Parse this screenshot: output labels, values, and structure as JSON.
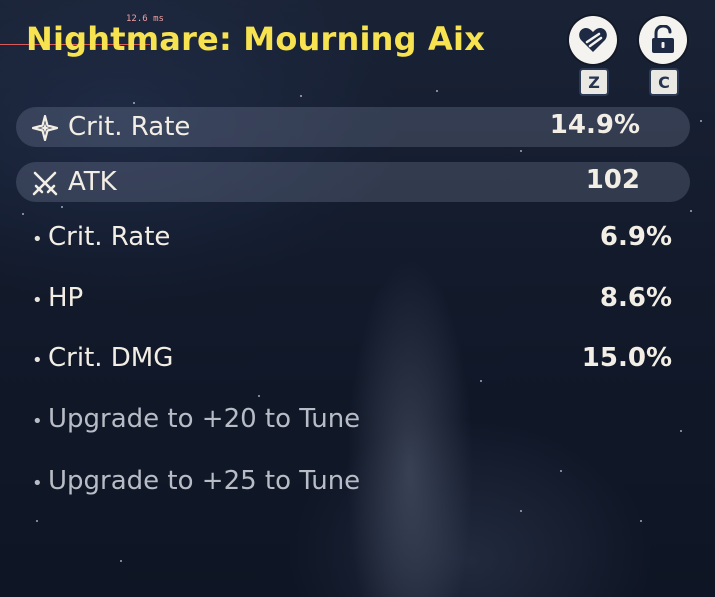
{
  "debug": {
    "frame_time": "12.6 ms"
  },
  "echo": {
    "title": "Nightmare: Mourning Aix",
    "actions": [
      {
        "icon": "heart-favorite-icon",
        "key": "Z"
      },
      {
        "icon": "unlock-icon",
        "key": "C"
      }
    ],
    "main_stats": [
      {
        "icon": "crit-star-icon",
        "label": "Crit. Rate",
        "value": "14.9%"
      },
      {
        "icon": "crossed-swords-icon",
        "label": "ATK",
        "value": "102"
      }
    ],
    "sub_stats": [
      {
        "label": "Crit. Rate",
        "value": "6.9%"
      },
      {
        "label": "HP",
        "value": "8.6%"
      },
      {
        "label": "Crit. DMG",
        "value": "15.0%"
      }
    ],
    "locked_slots": [
      {
        "label": "Upgrade to +20 to Tune"
      },
      {
        "label": "Upgrade to +25 to Tune"
      }
    ]
  },
  "colors": {
    "title": "#f7e24f",
    "text": "#f3eee5",
    "locked_text": "#b8bcc6",
    "row_highlight": "rgba(160,170,195,0.22)"
  }
}
